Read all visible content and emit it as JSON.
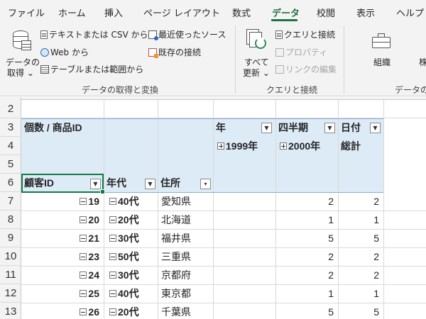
{
  "menu": {
    "tabs": [
      "ファイル",
      "ホーム",
      "挿入",
      "ページ レイアウト",
      "数式",
      "データ",
      "校閲",
      "表示",
      "ヘルプ"
    ],
    "active_tab": "データ"
  },
  "ribbon": {
    "get_data": {
      "line1": "データの",
      "line2": "取得",
      "chevron": "⌄"
    },
    "text_csv": "テキストまたは CSV から",
    "web": "Web から",
    "table_range": "テーブルまたは範囲から",
    "recent_sources": "最近使ったソース",
    "existing_connections": "既存の接続",
    "refresh_all": {
      "line1": "すべて",
      "line2": "更新",
      "chevron": "⌄"
    },
    "queries_connections": "クエリと接続",
    "properties": "プロパティ",
    "edit_links": "リンクの編集",
    "organization": "組織",
    "org_partial": "株",
    "groups": {
      "get_transform": "データの取得と変換",
      "queries": "クエリと接続",
      "data_types": "データの種"
    }
  },
  "grid": {
    "row_numbers": [
      "2",
      "3",
      "4",
      "5",
      "6",
      "7",
      "8",
      "9",
      "10",
      "11",
      "12",
      "13"
    ],
    "pivot": {
      "values_header": "個数 / 商品ID",
      "col_field_year": "年",
      "col_field_quarter": "四半期",
      "col_field_date": "日付",
      "year_1999": "1999年",
      "year_2000": "2000年",
      "grand_total": "総計",
      "row_field_customer": "顧客ID",
      "row_field_age": "年代",
      "row_field_address": "住所",
      "rows": [
        {
          "id": "19",
          "age": "40代",
          "address": "愛知県",
          "v2000": "2",
          "total": "2"
        },
        {
          "id": "20",
          "age": "20代",
          "address": "北海道",
          "v2000": "1",
          "total": "1"
        },
        {
          "id": "21",
          "age": "30代",
          "address": "福井県",
          "v2000": "5",
          "total": "5"
        },
        {
          "id": "23",
          "age": "50代",
          "address": "三重県",
          "v2000": "2",
          "total": "2"
        },
        {
          "id": "24",
          "age": "30代",
          "address": "京都府",
          "v2000": "2",
          "total": "2"
        },
        {
          "id": "25",
          "age": "40代",
          "address": "東京都",
          "v2000": "1",
          "total": "1"
        },
        {
          "id": "26",
          "age": "20代",
          "address": "千葉県",
          "v2000": "5",
          "total": "5"
        }
      ]
    }
  },
  "colors": {
    "accent": "#1e7145",
    "pivot_header_bg": "#ddebf7",
    "ribbon_bg": "#f3f3f3"
  }
}
